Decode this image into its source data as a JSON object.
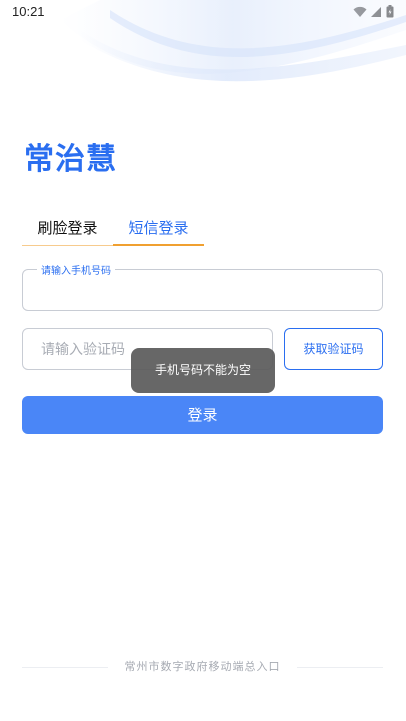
{
  "status_bar": {
    "time": "10:21",
    "icons": [
      "wifi-icon",
      "signal-icon",
      "battery-icon"
    ]
  },
  "app": {
    "logo_text": "常治慧",
    "brand_color": "#2a6ef0"
  },
  "tabs": [
    {
      "label": "刷脸登录",
      "active": false
    },
    {
      "label": "短信登录",
      "active": true
    }
  ],
  "phone_field": {
    "label": "请输入手机号码",
    "value": ""
  },
  "code_field": {
    "placeholder": "请输入验证码",
    "value": ""
  },
  "get_code_button": {
    "label": "获取验证码"
  },
  "login_button": {
    "label": "登录"
  },
  "toast": {
    "message": "手机号码不能为空"
  },
  "footer": {
    "text": "常州市数字政府移动端总入口"
  },
  "colors": {
    "accent": "#2a6ef0",
    "button": "#4a86f7",
    "tab_underline": "#f0a030"
  }
}
